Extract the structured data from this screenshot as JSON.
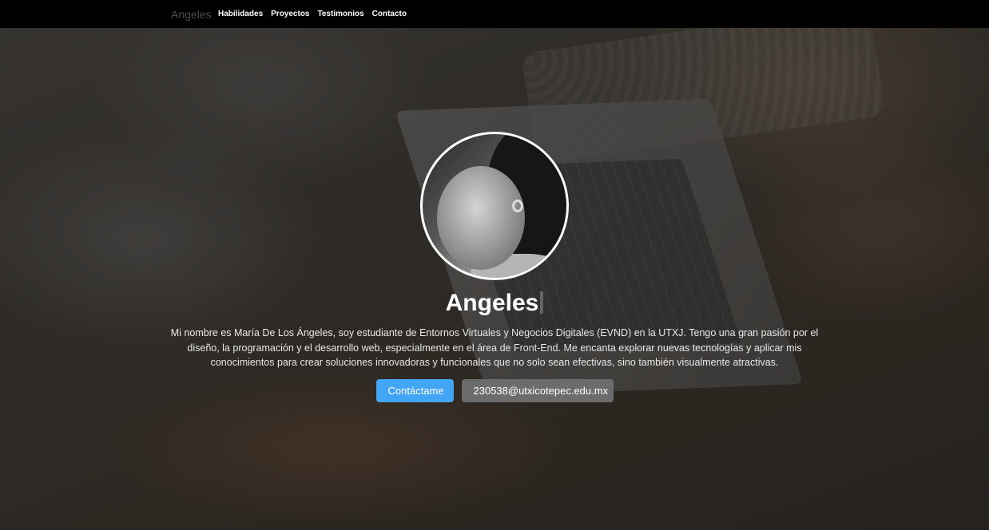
{
  "navbar": {
    "brand": "Angeles",
    "links": [
      "Habilidades",
      "Proyectos",
      "Testimonios",
      "Contacto"
    ]
  },
  "hero": {
    "name": "Angeles",
    "description": "Mi nombre es María De Los Ángeles, soy estudiante de Entornos Virtuales y Negocios Digitales (EVND) en la UTXJ. Tengo una gran pasión por el diseño, la programación y el desarrollo web, especialmente en el área de Front-End. Me encanta explorar nuevas tecnologías y aplicar mis conocimientos para crear soluciones innovadoras y funcionales que no solo sean efectivas, sino también visualmente atractivas.",
    "contact_button": "Contáctame",
    "email_button": "230538@utxicotepec.edu.mx"
  },
  "colors": {
    "navbar_bg": "#000000",
    "primary_button": "#42a5f5",
    "secondary_button": "#6c6c6c"
  }
}
